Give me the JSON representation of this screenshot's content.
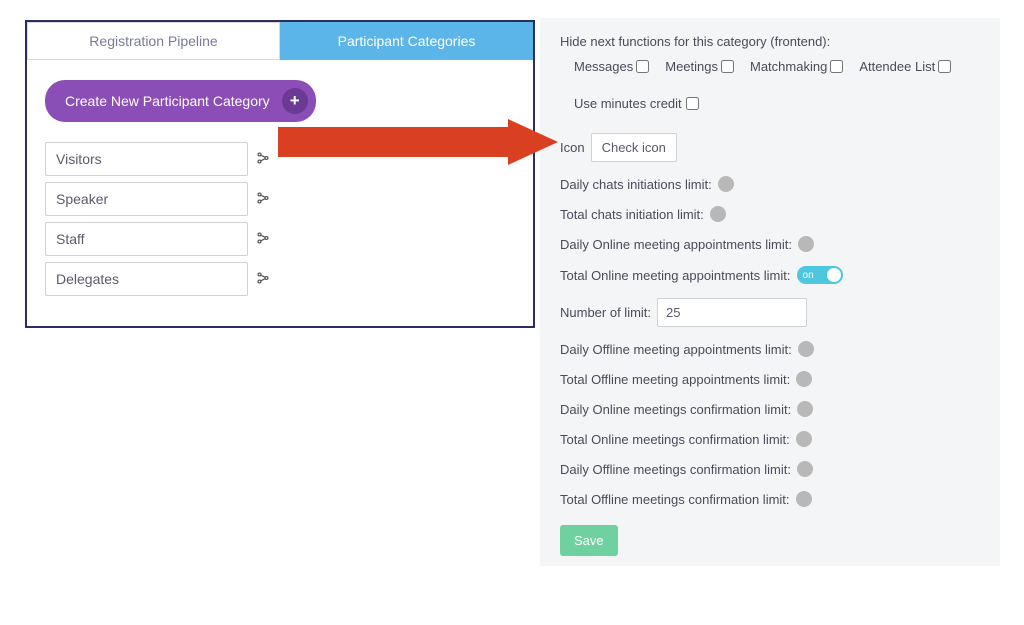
{
  "tabs": {
    "registration": "Registration Pipeline",
    "participant": "Participant Categories"
  },
  "createBtn": "Create New Participant Category",
  "categories": [
    "Visitors",
    "Speaker",
    "Staff",
    "Delegates"
  ],
  "right": {
    "hideHeading": "Hide next functions for this category (frontend):",
    "messages": "Messages",
    "meetings": "Meetings",
    "matchmaking": "Matchmaking",
    "attendee": "Attendee List",
    "useCredit": "Use minutes credit",
    "iconLabel": "Icon",
    "checkIcon": "Check icon",
    "dailyChats": "Daily chats initiations limit:",
    "totalChats": "Total chats initiation limit:",
    "dailyOnlineAppt": "Daily Online meeting appointments limit:",
    "totalOnlineAppt": "Total Online meeting appointments limit:",
    "onLabel": "on",
    "numLimit": "Number of limit:",
    "numValue": "25",
    "dailyOfflineAppt": "Daily Offline meeting appointments limit:",
    "totalOfflineAppt": "Total Offline meeting appointments limit:",
    "dailyOnlineConf": "Daily Online meetings confirmation limit:",
    "totalOnlineConf": "Total Online meetings confirmation limit:",
    "dailyOfflineConf": "Daily Offline meetings confirmation limit:",
    "totalOfflineConf": "Total Offline meetings confirmation limit:",
    "save": "Save"
  }
}
